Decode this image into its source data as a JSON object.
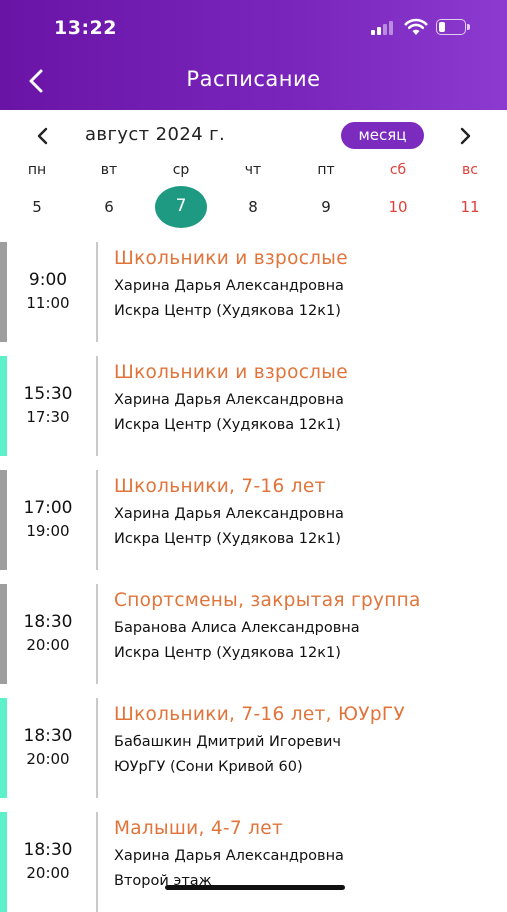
{
  "status_bar": {
    "time": "13:22",
    "battery_percent": 25
  },
  "header": {
    "title": "Расписание"
  },
  "calendar": {
    "month_label": "август 2024 г.",
    "mode": "месяц",
    "weekdays": [
      "пн",
      "вт",
      "ср",
      "чт",
      "пт",
      "сб",
      "вс"
    ],
    "days": [
      "5",
      "6",
      "7",
      "8",
      "9",
      "10",
      "11"
    ],
    "selected_index": 2,
    "weekend_color": "#e0403a",
    "selected_color": "#1e9a82"
  },
  "colors": {
    "header_gradient": [
      "#6a14a6",
      "#8c3ad0"
    ],
    "accent_title": "#e0743a",
    "bar_gray": "#9e9e9e",
    "bar_teal": "#5ef0c8"
  },
  "sessions": [
    {
      "start": "9:00",
      "end": "11:00",
      "title": "Школьники и взрослые",
      "trainer": "Харина Дарья Александровна",
      "location": "Искра Центр (Худякова 12к1)",
      "bar_color": "#9e9e9e"
    },
    {
      "start": "15:30",
      "end": "17:30",
      "title": "Школьники и взрослые",
      "trainer": "Харина Дарья Александровна",
      "location": "Искра Центр (Худякова 12к1)",
      "bar_color": "#5ef0c8"
    },
    {
      "start": "17:00",
      "end": "19:00",
      "title": "Школьники, 7-16 лет",
      "trainer": "Харина Дарья Александровна",
      "location": "Искра Центр (Худякова 12к1)",
      "bar_color": "#9e9e9e"
    },
    {
      "start": "18:30",
      "end": "20:00",
      "title": "Спортсмены, закрытая группа",
      "trainer": "Баранова Алиса Александровна",
      "location": "Искра Центр (Худякова 12к1)",
      "bar_color": "#9e9e9e"
    },
    {
      "start": "18:30",
      "end": "20:00",
      "title": "Школьники, 7-16 лет, ЮУрГУ",
      "trainer": "Бабашкин Дмитрий Игоревич",
      "location": "ЮУрГУ (Сони Кривой 60)",
      "bar_color": "#5ef0c8"
    },
    {
      "start": "18:30",
      "end": "20:00",
      "title": "Малыши, 4-7 лет",
      "trainer": "Харина Дарья Александровна",
      "location": "Второй этаж",
      "bar_color": "#5ef0c8"
    }
  ]
}
